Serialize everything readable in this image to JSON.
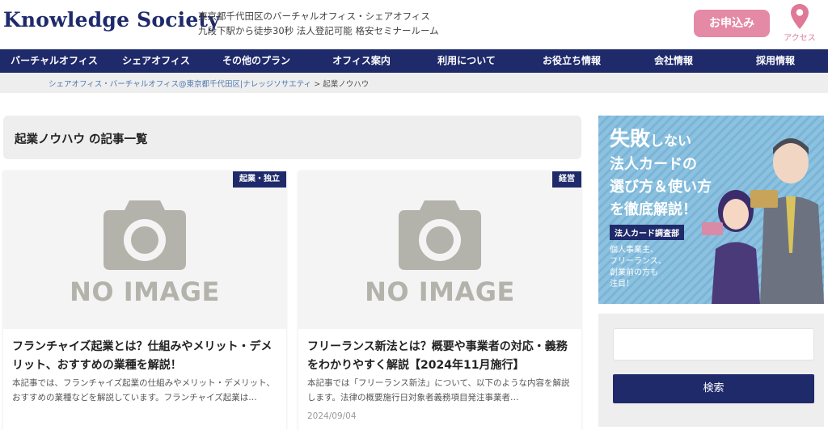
{
  "header": {
    "logo": "Knowledge Society",
    "tagline_line1": "東京都千代田区のバーチャルオフィス・シェアオフィス",
    "tagline_line2": "九段下駅から徒歩30秒 法人登記可能 格安セミナールーム",
    "apply_label": "お申込み",
    "access_label": "アクセス",
    "accent_color": "#e48aa6",
    "brand_color": "#1f2a6b"
  },
  "nav": {
    "items": [
      {
        "label": "バーチャルオフィス"
      },
      {
        "label": "シェアオフィス"
      },
      {
        "label": "その他のプラン"
      },
      {
        "label": "オフィス案内"
      },
      {
        "label": "利用について"
      },
      {
        "label": "お役立ち情報"
      },
      {
        "label": "会社情報"
      },
      {
        "label": "採用情報"
      }
    ]
  },
  "breadcrumb": {
    "home": "シェアオフィス・バーチャルオフィス@東京都千代田区|ナレッジソサエティ",
    "separator": ">",
    "current": "起業ノウハウ"
  },
  "archive": {
    "title": "起業ノウハウ の記事一覧"
  },
  "cards": [
    {
      "category": "起業・独立",
      "image_text": "NO IMAGE",
      "title": "フランチャイズ起業とは？仕組みやメリット・デメリット、おすすめの業種を解説！",
      "excerpt": "本記事では、フランチャイズ起業の仕組みやメリット・デメリット、おすすめの業種などを解説しています。フランチャイズ起業は…",
      "date": ""
    },
    {
      "category": "経営",
      "image_text": "NO IMAGE",
      "title": "フリーランス新法とは？概要や事業者の対応・義務をわかりやすく解説【2024年11月施行】",
      "excerpt": "本記事では「フリーランス新法」について、以下のような内容を解説します。法律の概要施行日対象者義務項目発注事業者…",
      "date": "2024/09/04"
    }
  ],
  "sidebar": {
    "banner": {
      "line1_big": "失敗",
      "line1_small": "しない",
      "line2": "法人カードの",
      "line3": "選び方＆使い方",
      "line4": "を徹底解説！",
      "tag": "法人カード調査部",
      "sub1": "個人事業主、",
      "sub2": "フリーランス、",
      "sub3": "創業前の方も",
      "sub4": "注目！"
    },
    "search": {
      "placeholder": "",
      "button_label": "検索"
    }
  }
}
